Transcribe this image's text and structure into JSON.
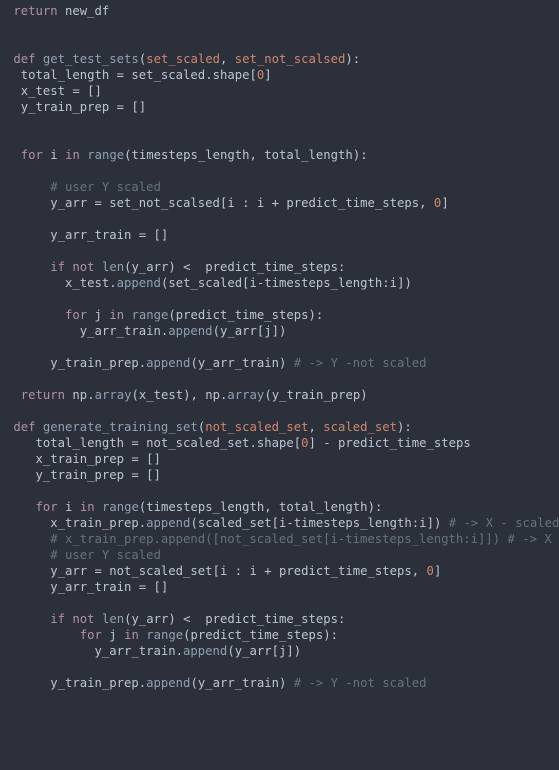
{
  "code": {
    "l01_kw_return": "return",
    "l01_var": "new_df",
    "l04_kw_def": "def",
    "l04_fn": "get_test_sets",
    "l04_prm1": "set_scaled",
    "l04_prm2": "set_not_scalsed",
    "l05_var1": "total_length",
    "l05_var2": "set_scaled",
    "l05_attr": "shape",
    "l05_num0": "0",
    "l06_var": "x_test",
    "l07_var": "y_train_prep",
    "l10_kw_for": "for",
    "l10_var_i": "i",
    "l10_kw_in": "in",
    "l10_fn_range": "range",
    "l10_arg1": "timesteps_length",
    "l10_arg2": "total_length",
    "l12_cmt": "# user Y scaled",
    "l13_var": "y_arr",
    "l13_src": "set_not_scalsed",
    "l13_i": "i",
    "l13_i2": "i",
    "l13_pts": "predict_time_steps",
    "l13_num0": "0",
    "l15_var": "y_arr_train",
    "l17_kw_if": "if",
    "l17_kw_not": "not",
    "l17_fn_len": "len",
    "l17_arg": "y_arr",
    "l17_rhs": "predict_time_steps",
    "l18_obj": "x_test",
    "l18_meth": "append",
    "l18_arg_src": "set_scaled",
    "l18_idx1": "i",
    "l18_idx2": "timesteps_length",
    "l18_idx3": "i",
    "l20_kw_for": "for",
    "l20_var_j": "j",
    "l20_kw_in": "in",
    "l20_fn_range": "range",
    "l20_arg": "predict_time_steps",
    "l21_obj": "y_arr_train",
    "l21_meth": "append",
    "l21_src": "y_arr",
    "l21_idx": "j",
    "l23_obj": "y_train_prep",
    "l23_meth": "append",
    "l23_arg": "y_arr_train",
    "l23_cmt": "# -> Y -not scaled",
    "l25_kw_return": "return",
    "l25_np1": "np",
    "l25_array1": "array",
    "l25_arg1": "x_test",
    "l25_np2": "np",
    "l25_array2": "array",
    "l25_arg2": "y_train_prep",
    "l27_kw_def": "def",
    "l27_fn": "generate_training_set",
    "l27_prm1": "not_scaled_set",
    "l27_prm2": "scaled_set",
    "l28_var1": "total_length",
    "l28_src": "not_scaled_set",
    "l28_attr": "shape",
    "l28_num0": "0",
    "l28_rhs": "predict_time_steps",
    "l29_var": "x_train_prep",
    "l30_var": "y_train_prep",
    "l32_kw_for": "for",
    "l32_var_i": "i",
    "l32_kw_in": "in",
    "l32_fn_range": "range",
    "l32_arg1": "timesteps_length",
    "l32_arg2": "total_length",
    "l33_obj": "x_train_prep",
    "l33_meth": "append",
    "l33_src": "scaled_set",
    "l33_idx1": "i",
    "l33_idx2": "timesteps_length",
    "l33_idx3": "i",
    "l33_cmt": "# -> X - scaled",
    "l34_cmt": "# x_train_prep.append([not_scaled_set[i-timesteps_length:i]]) # -> X - not scaled",
    "l35_cmt": "# user Y scaled",
    "l36_var": "y_arr",
    "l36_src": "not_scaled_set",
    "l36_i": "i",
    "l36_i2": "i",
    "l36_pts": "predict_time_steps",
    "l36_num0": "0",
    "l37_var": "y_arr_train",
    "l39_kw_if": "if",
    "l39_kw_not": "not",
    "l39_fn_len": "len",
    "l39_arg": "y_arr",
    "l39_rhs": "predict_time_steps",
    "l40_kw_for": "for",
    "l40_var_j": "j",
    "l40_kw_in": "in",
    "l40_fn_range": "range",
    "l40_arg": "predict_time_steps",
    "l41_obj": "y_arr_train",
    "l41_meth": "append",
    "l41_src": "y_arr",
    "l41_idx": "j",
    "l43_obj": "y_train_prep",
    "l43_meth": "append",
    "l43_arg": "y_arr_train",
    "l43_cmt": "# -> Y -not scaled"
  }
}
